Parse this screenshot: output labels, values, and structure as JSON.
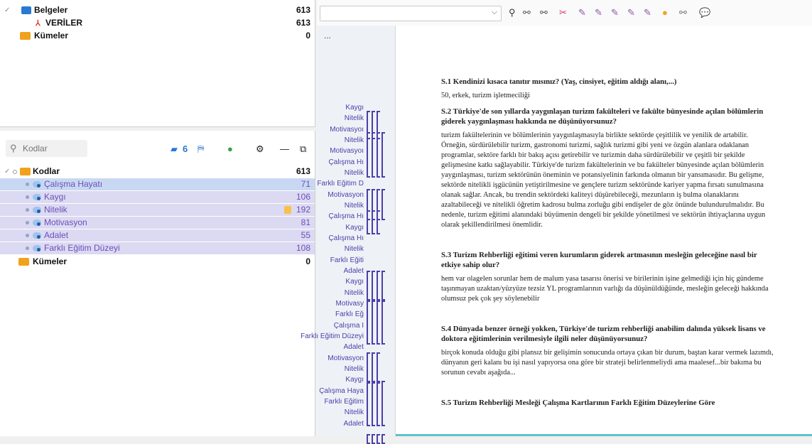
{
  "doc_tree": {
    "rows": [
      {
        "label": "Belgeler",
        "count": "613"
      },
      {
        "label": "VERİLER",
        "count": "613"
      },
      {
        "label": "Kümeler",
        "count": "0"
      }
    ]
  },
  "codes_panel": {
    "search_placeholder": "Kodlar",
    "toolbar": {
      "codes_count": "6"
    },
    "root": {
      "label": "Kodlar",
      "count": "613"
    },
    "codes": [
      {
        "label": "Çalışma Hayatı",
        "count": "71"
      },
      {
        "label": "Kaygı",
        "count": "106"
      },
      {
        "label": "Nitelik",
        "count": "192"
      },
      {
        "label": "Motivasyon",
        "count": "81"
      },
      {
        "label": "Adalet",
        "count": "55"
      },
      {
        "label": "Farklı Eğitim Düzeyi",
        "count": "108"
      }
    ],
    "sets": {
      "label": "Kümeler",
      "count": "0"
    }
  },
  "coding_stripe": {
    "labels": [
      "Kaygı",
      "Nitelik",
      "Motivasyoı",
      "Nitelik",
      "Motivasyoı",
      "Çalışma Hı",
      "Nitelik",
      "Farklı Eğitim D",
      "Motivasyon",
      "Nitelik",
      "Çalışma Hı",
      "Kaygı",
      "Çalışma Hı",
      "Nitelik",
      "Farklı Eğiti",
      "Adalet",
      "Kaygı",
      "Nitelik",
      "Motivasy",
      "Farklı Eğ",
      "Çalışma I",
      "Farklı Eğitim Düzeyi",
      "Adalet",
      "Motivasyon",
      "Nitelik",
      "Kaygı",
      "Çalışma Haya",
      "Farklı Eğitim",
      "Nitelik",
      "Adalet"
    ]
  },
  "document": {
    "more_label": "...",
    "blocks": [
      {
        "q": "S.1 Kendinizi kısaca tanıtır mısınız? (Yaş, cinsiyet, eğitim aldığı alanı,...)",
        "a": "50, erkek, turizm işletmeciliği"
      },
      {
        "q": "S.2 Türkiye'de son yıllarda yaygınlaşan turizm fakülteleri ve fakülte bünyesinde açılan bölümlerin giderek yaygınlaşması hakkında ne düşünüyorsunuz?",
        "a": "turizm fakültelerinin ve bölümlerinin yaygınlaşmasıyla birlikte sektörde çeşitlilik ve yenilik de artabilir. Örneğin, sürdürülebilir turizm, gastronomi turizmi, sağlık turizmi gibi yeni ve özgün alanlara odaklanan programlar, sektöre farklı bir bakış açısı getirebilir ve turizmin daha sürdürülebilir ve çeşitli bir şekilde gelişmesine katkı sağlayabilir. Türkiye'de turizm fakültelerinin ve bu fakülteler bünyesinde açılan bölümlerin yaygınlaşması, turizm sektörünün öneminin ve potansiyelinin farkında olmanın bir yansımasıdır. Bu gelişme, sektörde nitelikli işgücünün yetiştirilmesine ve gençlere turizm sektöründe kariyer yapma fırsatı sunulmasına olanak sağlar. Ancak, bu trendin sektördeki kaliteyi düşürebileceği, mezunların iş bulma olanaklarını azaltabileceği ve nitelikli öğretim kadrosu bulma zorluğu gibi endişeler de göz önünde bulundurulmalıdır. Bu nedenle, turizm eğitimi alanındaki büyümenin dengeli bir şekilde yönetilmesi ve sektörün ihtiyaçlarına uygun olarak şekillendirilmesi önemlidir."
      },
      {
        "q": "S.3 Turizm Rehberliği eğitimi veren kurumların giderek artmasının mesleğin geleceğine nasıl bir etkiye sahip olur?",
        "a": "hem var olagelen sorunlar hem de malum yasa tasarısı önerisi ve birilerinin işine gelmediği için hiç gündeme taşınmayan uzaktan/yüzyüze tezsiz YL programlarının varlığı da düşünüldüğünde, mesleğin geleceği hakkında olumsuz pek çok şey söylenebilir"
      },
      {
        "q": "S.4 Dünyada benzer örneği yokken, Türkiye'de turizm rehberliği anabilim dalında yüksek lisans ve doktora eğitimlerinin verilmesiyle ilgili neler düşünüyorsunuz?",
        "a": "birçok konuda olduğu gibi plansız bir gelişimin sonucunda ortaya çıkan bir durum, baştan karar vermek lazımdı, dünyanın geri kalanı bu işi nasıl yapıyorsa ona göre bir strateji belirlenmeliydi ama maalesef...bir bakıma bu sorunun cevabı aşağıda..."
      },
      {
        "q": "S.5 Turizm Rehberliği Mesleği Çalışma Kartlarının Farklı Eğitim Düzeylerine Göre",
        "a": ""
      }
    ]
  },
  "colors": {
    "accent": "#6b4fb8",
    "folder_blue": "#2b79d0",
    "folder_orange": "#f0a21c",
    "selection": "#c9d8f2",
    "code_bg": "#dcd9f2"
  }
}
